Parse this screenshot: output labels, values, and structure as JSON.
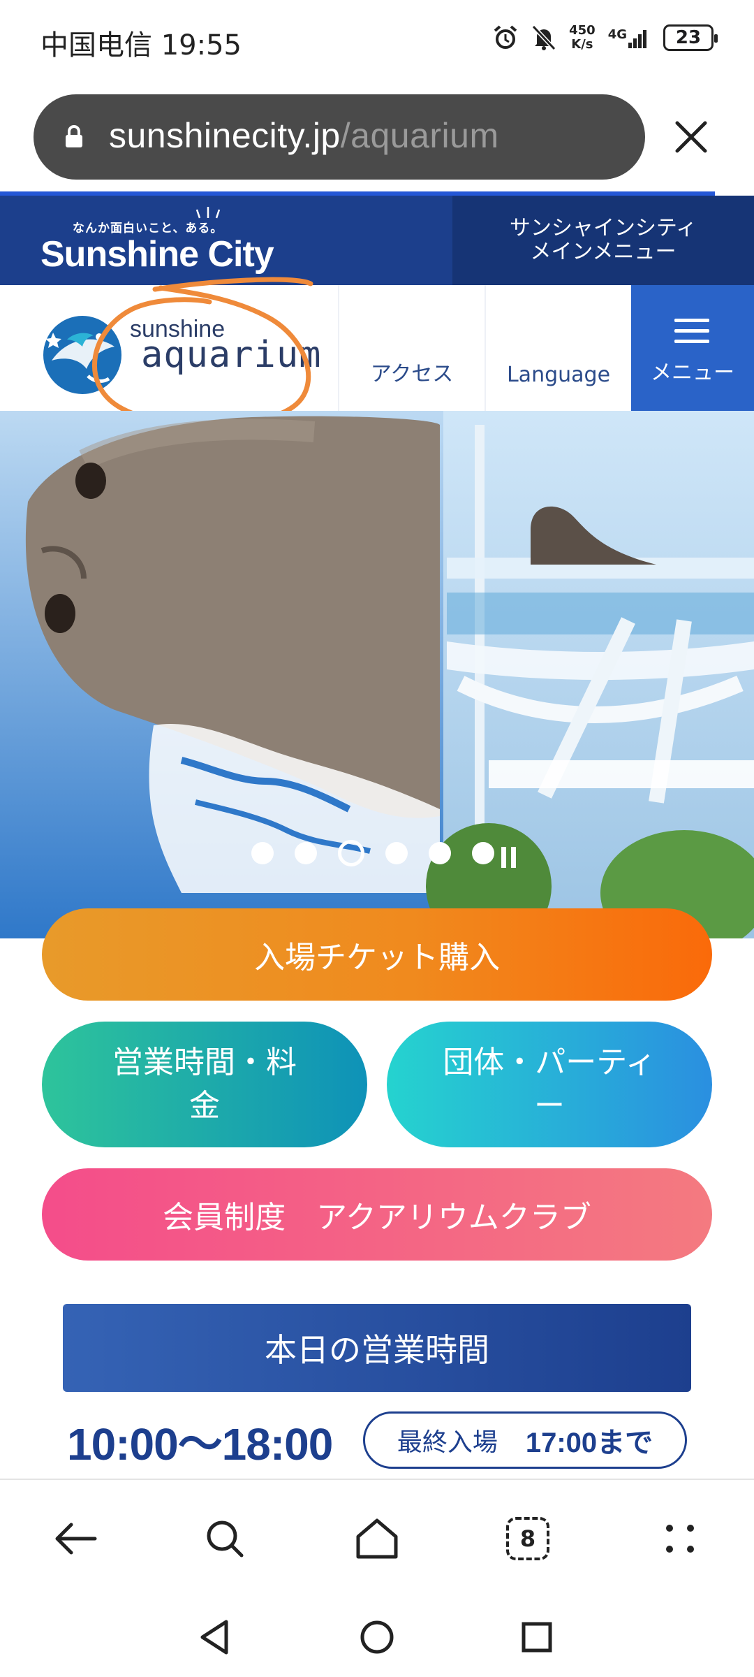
{
  "status_bar": {
    "carrier_time": "中国电信 19:55",
    "net_speed": "450\nK/s",
    "network": "4G",
    "battery": "23",
    "icons": [
      "alarm-icon",
      "mute-icon",
      "signal-icon",
      "battery-icon"
    ]
  },
  "address_bar": {
    "host": "sunshinecity.jp",
    "path": "/aquarium",
    "icons": [
      "lock-icon",
      "close-icon"
    ]
  },
  "sunshine_city_bar": {
    "tagline": "なんか面白いこと、ある。",
    "logo_text": "Sunshine City",
    "menu_line1": "サンシャインシティ",
    "menu_line2": "メインメニュー"
  },
  "aquarium_header": {
    "logo_line1": "sunshine",
    "logo_line2": "aquarium",
    "access": "アクセス",
    "language": "Language",
    "menu": "メニュー"
  },
  "hero": {
    "slide_count": 6,
    "active_slide_index": 2,
    "pause_icon": "pause-icon"
  },
  "buttons": {
    "ticket": "入場チケット購入",
    "hours_fee": "営業時間・料金",
    "group_party": "団体・パーティー",
    "membership": "会員制度　アクアリウムクラブ"
  },
  "today": {
    "heading": "本日の営業時間",
    "hours": "10:00〜18:00",
    "last_entry_label": "最終入場",
    "last_entry_time": "17:00まで"
  },
  "colors": {
    "brand_blue": "#1c3f8c",
    "ticket_orange": "#f08a1e",
    "hours_teal": "#1aa8b0",
    "group_cyan": "#2ab0dc",
    "member_pink": "#f45f86",
    "annotation_orange": "#ef8a3a"
  },
  "toolbar": {
    "icons": [
      "back-icon",
      "search-icon",
      "home-icon",
      "tabs-icon",
      "more-icon"
    ],
    "tab_count": "8"
  },
  "system_nav": {
    "icons": [
      "nav-back-icon",
      "nav-home-icon",
      "nav-recents-icon"
    ]
  }
}
